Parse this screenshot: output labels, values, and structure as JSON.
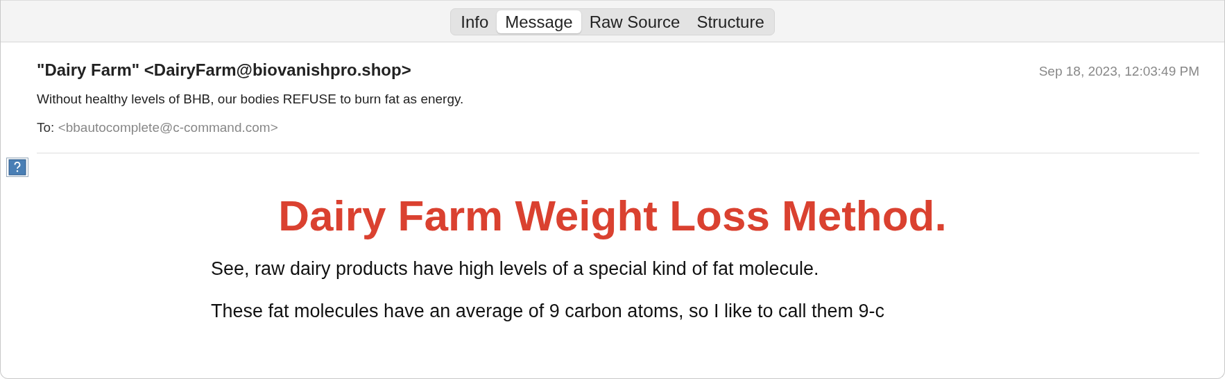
{
  "tabs": [
    {
      "label": "Info",
      "selected": false
    },
    {
      "label": "Message",
      "selected": true
    },
    {
      "label": "Raw Source",
      "selected": false
    },
    {
      "label": "Structure",
      "selected": false
    }
  ],
  "header": {
    "from": "\"Dairy Farm\" <DairyFarm@biovanishpro.shop>",
    "date": "Sep 18, 2023, 12:03:49 PM",
    "subject": "Without healthy levels of BHB, our bodies REFUSE to burn fat as energy.",
    "to_label": "To:",
    "to": "<bbautocomplete@c-command.com>"
  },
  "body": {
    "heading": "Dairy Farm Weight Loss Method.",
    "paragraphs": [
      "See, raw dairy products have high levels of a special kind of fat molecule.",
      "These fat molecules have an average of 9 carbon atoms, so I like to call them 9-c"
    ]
  }
}
